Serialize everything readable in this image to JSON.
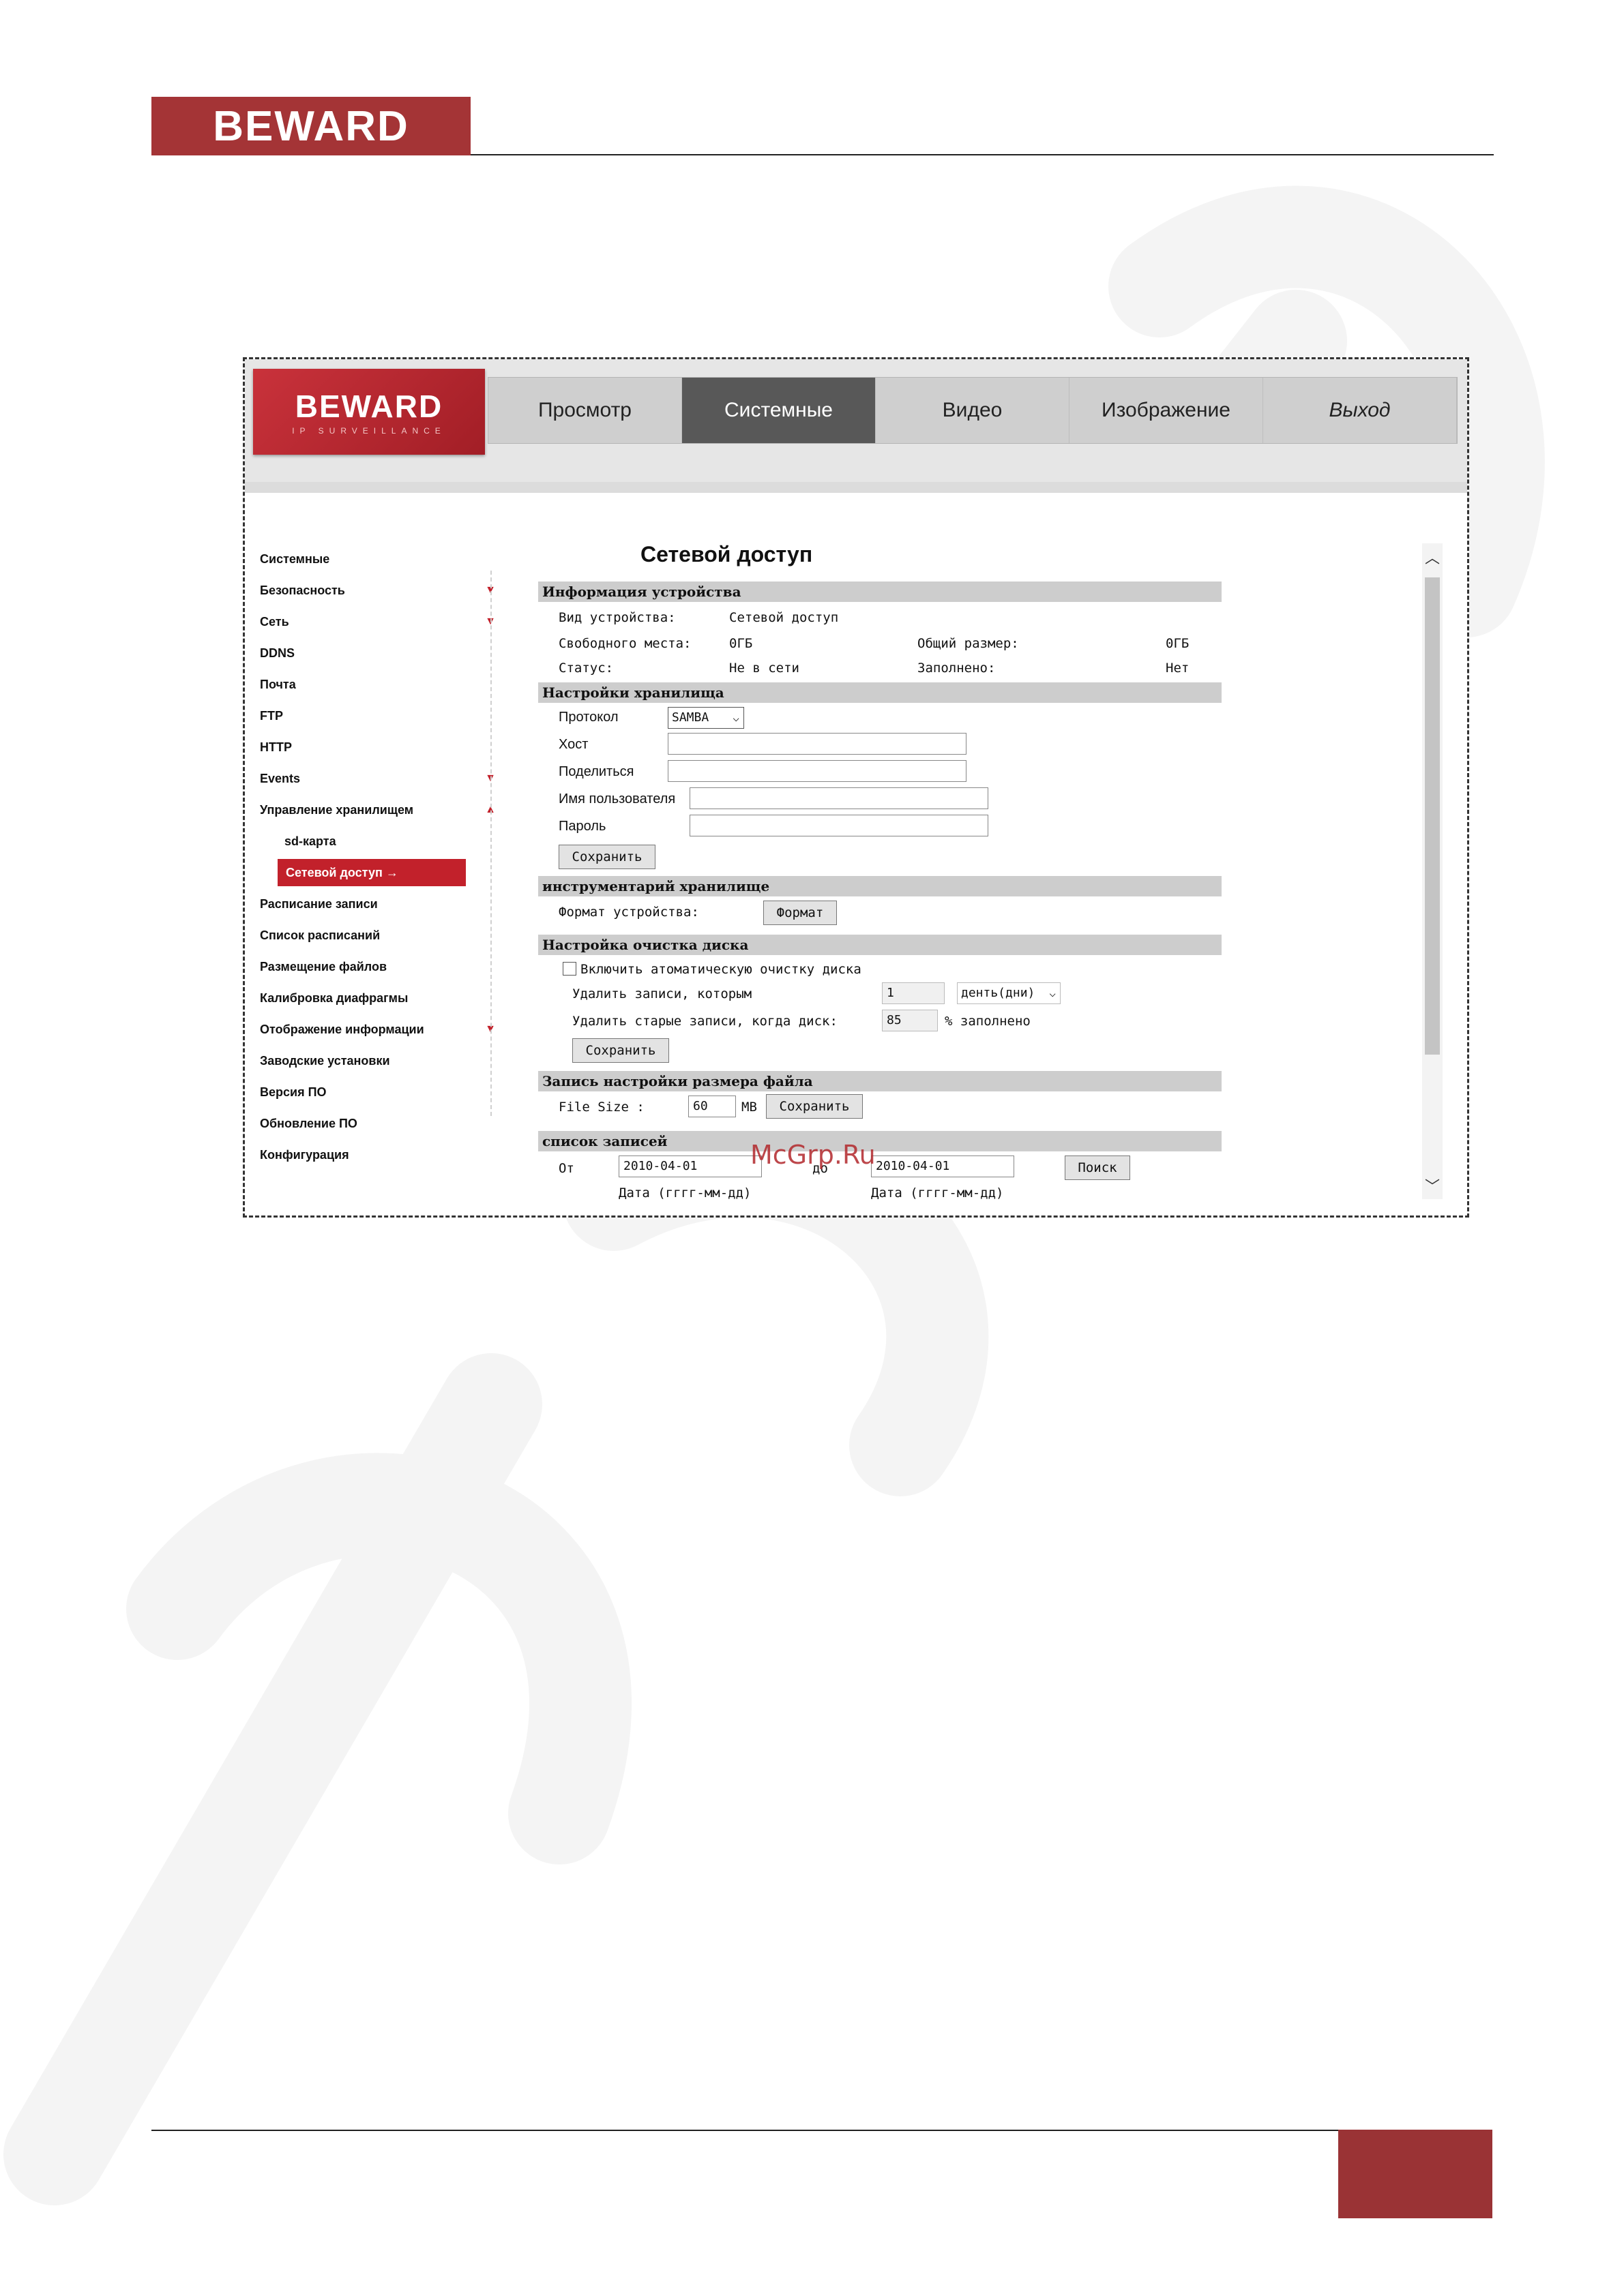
{
  "doc": {
    "logo": "BEWARD"
  },
  "ui": {
    "logo_main": "BEWARD",
    "logo_sub": "IP SURVEILLANCE",
    "nav": [
      "Просмотр",
      "Системные",
      "Видео",
      "Изображение",
      "Выход"
    ],
    "sidebar": [
      {
        "label": "Системные"
      },
      {
        "label": "Безопасность"
      },
      {
        "label": "Сеть"
      },
      {
        "label": "DDNS"
      },
      {
        "label": "Почта"
      },
      {
        "label": "FTP"
      },
      {
        "label": "HTTP"
      },
      {
        "label": "Events"
      },
      {
        "label": "Управление хранилищем"
      },
      {
        "label": "sd-карта"
      },
      {
        "label": "Сетевой доступ"
      },
      {
        "label": "Расписание записи"
      },
      {
        "label": "Список расписаний"
      },
      {
        "label": "Размещение файлов"
      },
      {
        "label": "Калибровка диафрагмы"
      },
      {
        "label": "Отображение информации"
      },
      {
        "label": "Заводские установки"
      },
      {
        "label": "Версия ПО"
      },
      {
        "label": "Обновление ПО"
      },
      {
        "label": "Конфигурация"
      }
    ],
    "active_arrow": "→",
    "page_title": "Сетевой доступ",
    "device_info": {
      "title": "Информация устройства",
      "type_label": "Вид устройства:",
      "type_value": "Сетевой доступ",
      "free_label": "Свободного места:",
      "free_value": "0ГБ",
      "total_label": "Общий размер:",
      "total_value": "0ГБ",
      "status_label": "Статус:",
      "status_value": "Не в сети",
      "full_label": "Заполнено:",
      "full_value": "Нет"
    },
    "storage": {
      "title": "Настройки хранилища",
      "protocol_label": "Протокол",
      "protocol_value": "SAMBA",
      "host_label": "Хост",
      "share_label": "Поделиться",
      "user_label": "Имя пользователя",
      "pass_label": "Пароль",
      "save": "Сохранить"
    },
    "tools": {
      "title": "инструментарий хранилище",
      "format_label": "Формат устройства:",
      "format_btn": "Формат"
    },
    "cleanup": {
      "title": "Настройка очистка диска",
      "enable_label": "Включить атоматическую очистку диска",
      "delete_label": "Удалить записи, которым",
      "days_value": "1",
      "days_unit": "денть(дни)",
      "old_label": "Удалить старые записи, когда диск:",
      "percent_value": "85",
      "percent_label": "% заполнено",
      "save": "Сохранить"
    },
    "filesize": {
      "title": "Запись настройки размера файла",
      "label": "File Size :",
      "value": "60",
      "unit": "MB",
      "save": "Сохранить"
    },
    "records": {
      "title": "список записей",
      "from_label": "От",
      "from_value": "2010-04-01",
      "to_label": "до",
      "to_value": "2010-04-01",
      "search": "Поиск",
      "date_hint": "Дата (гггг-мм-дд)"
    },
    "overlay": "McGrp.Ru"
  }
}
